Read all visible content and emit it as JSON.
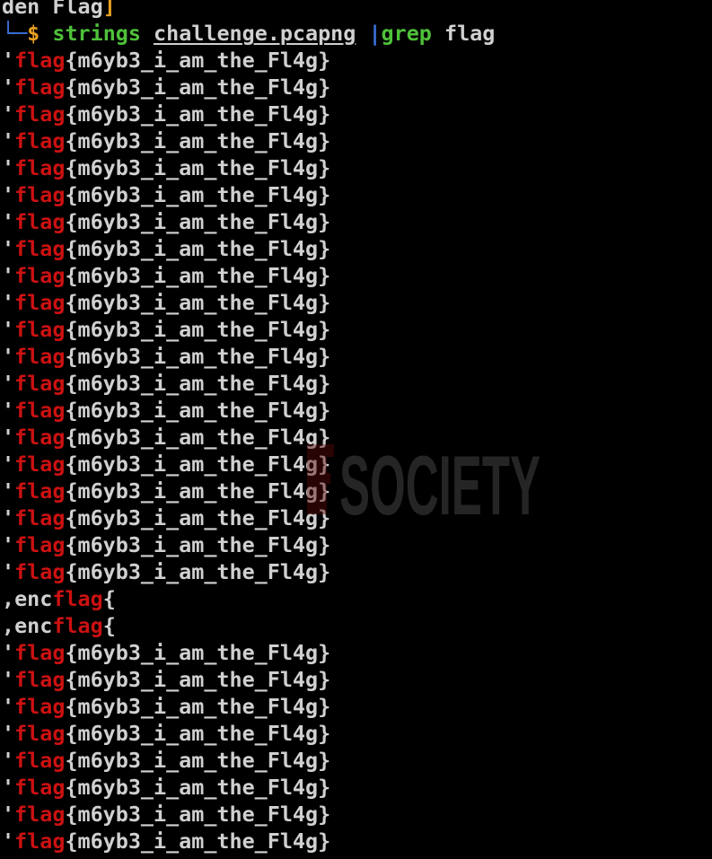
{
  "colors": {
    "background": "#000000",
    "text": "#d0d0d0",
    "match": "#cc1111",
    "prompt_bracket": "#e8a020",
    "prompt_dollar": "#e8a020",
    "command": "#4fc13a",
    "pipe": "#3a6fd8"
  },
  "header": {
    "prev_line_text": "den Flag",
    "prev_line_bracket": "]"
  },
  "prompt": {
    "corner": "└─",
    "dollar": "$",
    "command": "strings",
    "file": "challenge.pcapng",
    "pipe": "|",
    "grep": "grep",
    "pattern": "flag"
  },
  "output_lines": [
    {
      "prefix": "'",
      "match": "flag",
      "rest": "{m6yb3_i_am_the_Fl4g}"
    },
    {
      "prefix": "'",
      "match": "flag",
      "rest": "{m6yb3_i_am_the_Fl4g}"
    },
    {
      "prefix": "'",
      "match": "flag",
      "rest": "{m6yb3_i_am_the_Fl4g}"
    },
    {
      "prefix": "'",
      "match": "flag",
      "rest": "{m6yb3_i_am_the_Fl4g}"
    },
    {
      "prefix": "'",
      "match": "flag",
      "rest": "{m6yb3_i_am_the_Fl4g}"
    },
    {
      "prefix": "'",
      "match": "flag",
      "rest": "{m6yb3_i_am_the_Fl4g}"
    },
    {
      "prefix": "'",
      "match": "flag",
      "rest": "{m6yb3_i_am_the_Fl4g}"
    },
    {
      "prefix": "'",
      "match": "flag",
      "rest": "{m6yb3_i_am_the_Fl4g}"
    },
    {
      "prefix": "'",
      "match": "flag",
      "rest": "{m6yb3_i_am_the_Fl4g}"
    },
    {
      "prefix": "'",
      "match": "flag",
      "rest": "{m6yb3_i_am_the_Fl4g}"
    },
    {
      "prefix": "'",
      "match": "flag",
      "rest": "{m6yb3_i_am_the_Fl4g}"
    },
    {
      "prefix": "'",
      "match": "flag",
      "rest": "{m6yb3_i_am_the_Fl4g}"
    },
    {
      "prefix": "'",
      "match": "flag",
      "rest": "{m6yb3_i_am_the_Fl4g}"
    },
    {
      "prefix": "'",
      "match": "flag",
      "rest": "{m6yb3_i_am_the_Fl4g}"
    },
    {
      "prefix": "'",
      "match": "flag",
      "rest": "{m6yb3_i_am_the_Fl4g}"
    },
    {
      "prefix": "'",
      "match": "flag",
      "rest": "{m6yb3_i_am_the_Fl4g}"
    },
    {
      "prefix": "'",
      "match": "flag",
      "rest": "{m6yb3_i_am_the_Fl4g}"
    },
    {
      "prefix": "'",
      "match": "flag",
      "rest": "{m6yb3_i_am_the_Fl4g}"
    },
    {
      "prefix": "'",
      "match": "flag",
      "rest": "{m6yb3_i_am_the_Fl4g}"
    },
    {
      "prefix": "'",
      "match": "flag",
      "rest": "{m6yb3_i_am_the_Fl4g}"
    },
    {
      "prefix": ",enc",
      "match": "flag",
      "rest": "{"
    },
    {
      "prefix": ",enc",
      "match": "flag",
      "rest": "{"
    },
    {
      "prefix": "'",
      "match": "flag",
      "rest": "{m6yb3_i_am_the_Fl4g}"
    },
    {
      "prefix": "'",
      "match": "flag",
      "rest": "{m6yb3_i_am_the_Fl4g}"
    },
    {
      "prefix": "'",
      "match": "flag",
      "rest": "{m6yb3_i_am_the_Fl4g}"
    },
    {
      "prefix": "'",
      "match": "flag",
      "rest": "{m6yb3_i_am_the_Fl4g}"
    },
    {
      "prefix": "'",
      "match": "flag",
      "rest": "{m6yb3_i_am_the_Fl4g}"
    },
    {
      "prefix": "'",
      "match": "flag",
      "rest": "{m6yb3_i_am_the_Fl4g}"
    },
    {
      "prefix": "'",
      "match": "flag",
      "rest": "{m6yb3_i_am_the_Fl4g}"
    },
    {
      "prefix": "'",
      "match": "flag",
      "rest": "{m6yb3_i_am_the_Fl4g}"
    }
  ],
  "watermark": {
    "text": "SOCIETY",
    "icon": "fsociety-mask-icon"
  }
}
